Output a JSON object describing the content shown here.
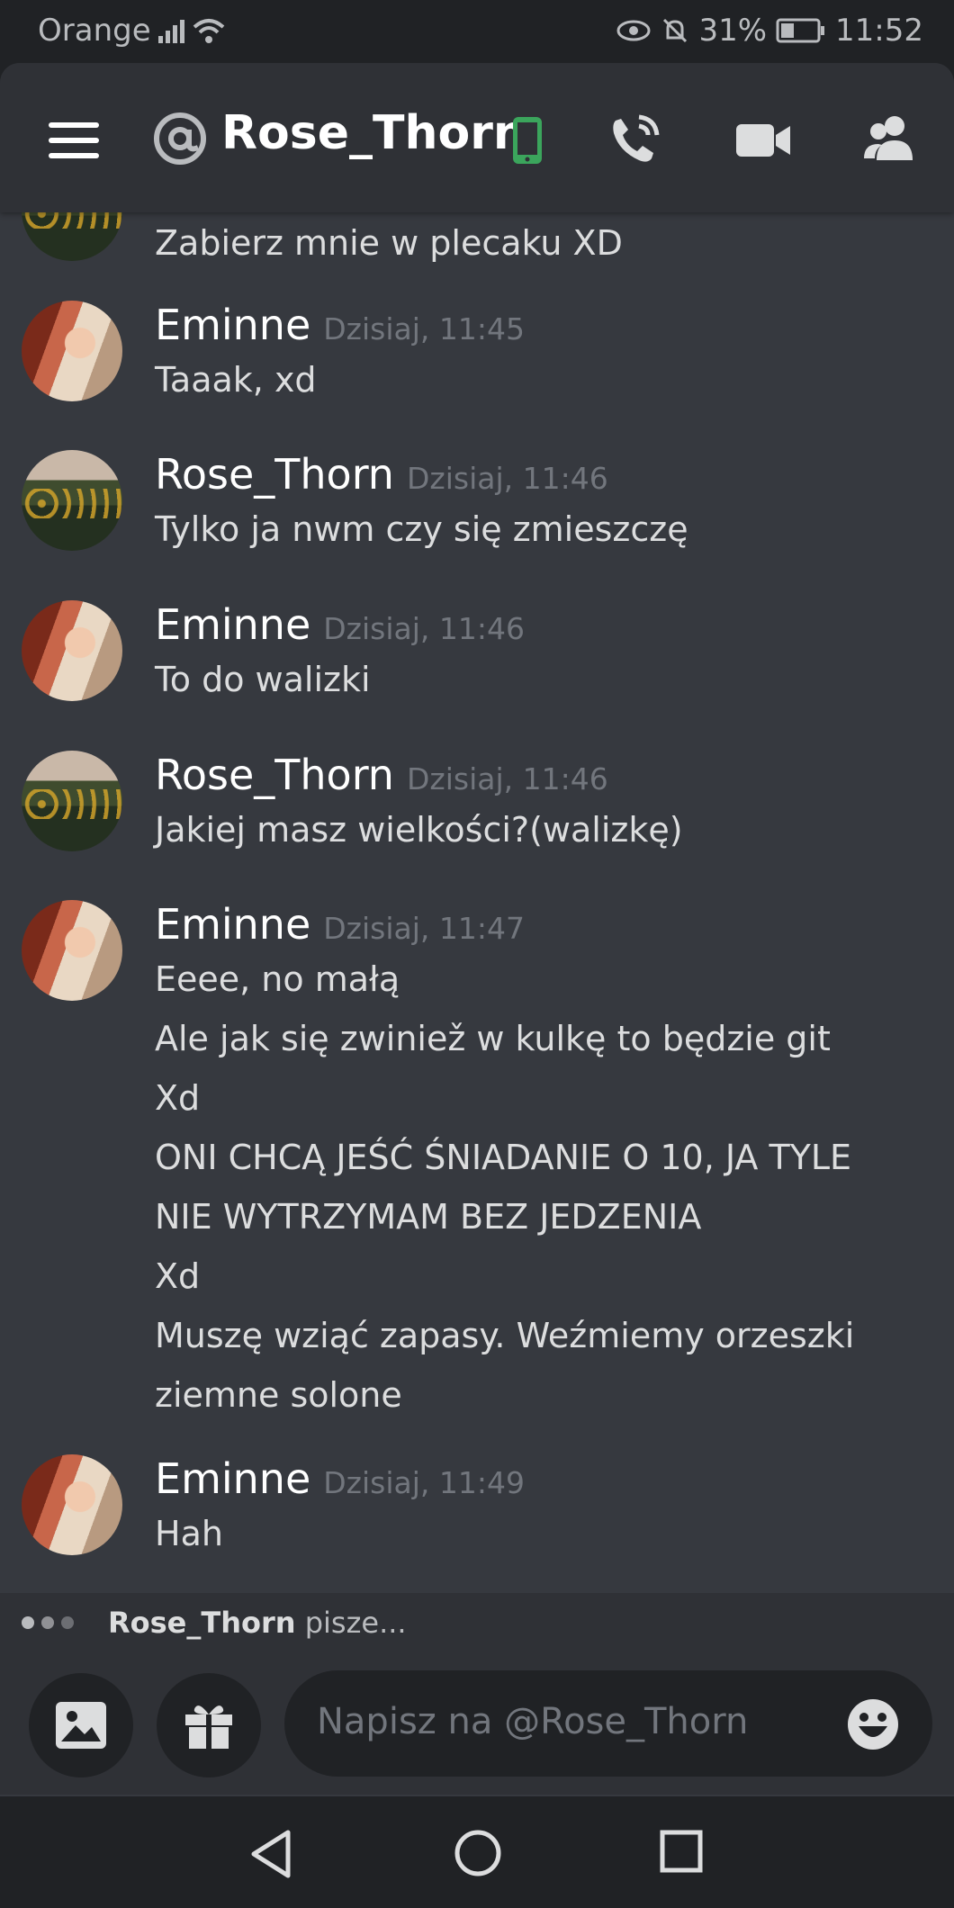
{
  "status_bar": {
    "carrier": "Orange",
    "battery": "31%",
    "time": "11:52"
  },
  "header": {
    "title": "Rose_Thorn",
    "icons": [
      "menu-icon",
      "at-icon",
      "mobile-phone-icon",
      "voice-call-icon",
      "video-call-icon",
      "members-icon"
    ]
  },
  "messages": [
    {
      "author": "",
      "time": "",
      "lines": [
        "Zabierz mnie w plecaku XD"
      ]
    },
    {
      "author": "Eminne",
      "time": "Dzisiaj, 11:45",
      "lines": [
        "Taaak, xd"
      ]
    },
    {
      "author": "Rose_Thorn",
      "time": "Dzisiaj, 11:46",
      "lines": [
        "Tylko ja nwm czy się zmieszczę"
      ]
    },
    {
      "author": "Eminne",
      "time": "Dzisiaj, 11:46",
      "lines": [
        "To do walizki"
      ]
    },
    {
      "author": "Rose_Thorn",
      "time": "Dzisiaj, 11:46",
      "lines": [
        "Jakiej masz wielkości?(walizkę)"
      ]
    },
    {
      "author": "Eminne",
      "time": "Dzisiaj, 11:47",
      "lines": [
        "Eeee, no małą",
        "Ale jak się zwiniež w kulkę to będzie git",
        "Xd",
        "ONI CHCĄ JEŚĆ ŚNIADANIE O 10, JA TYLE",
        "NIE WYTRZYMAM BEZ JEDZENIA",
        "Xd",
        "Muszę wziąć zapasy. Weźmiemy orzeszki",
        "ziemne solone"
      ]
    },
    {
      "author": "Eminne",
      "time": "Dzisiaj, 11:49",
      "lines": [
        "Hah"
      ]
    }
  ],
  "typing": {
    "user": "Rose_Thorn",
    "suffix": " pisze..."
  },
  "composer": {
    "placeholder": "Napisz na @Rose_Thorn"
  },
  "colors": {
    "background": "#36393f",
    "header": "#2f3136",
    "accent_green": "#3ba55c",
    "muted": "#72767d"
  }
}
